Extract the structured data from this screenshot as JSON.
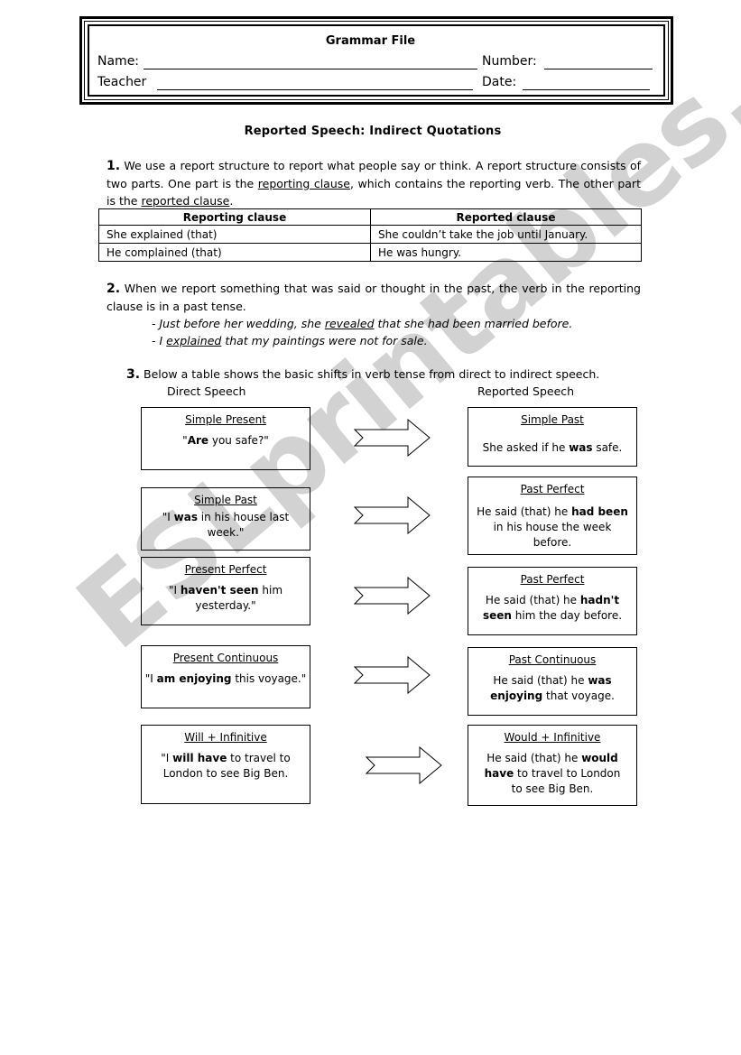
{
  "watermark": "ESLprintables.com",
  "header": {
    "title": "Grammar File",
    "name_label": "Name:",
    "number_label": "Number:",
    "teacher_label": "Teacher",
    "date_label": "Date:"
  },
  "document_title": "Reported Speech: Indirect Quotations",
  "section1": {
    "number": "1.",
    "text_before": " We use a report structure to report what people say or think. A report structure consists of two parts. One part is the ",
    "term1": "reporting clause",
    "text_middle": ", which contains the reporting verb. The other part is the ",
    "term2": "reported clause",
    "text_end": ".",
    "table": {
      "headers": [
        "Reporting clause",
        "Reported clause"
      ],
      "rows": [
        [
          "She explained (that)",
          "She couldn’t take the job until January."
        ],
        [
          "He complained (that)",
          "He was hungry."
        ]
      ]
    }
  },
  "section2": {
    "number": "2.",
    "text": " When we report something that was said or thought in the past, the verb in the reporting clause is in a past tense.",
    "examples": [
      {
        "before": "- Just before her wedding, she ",
        "verb": "revealed",
        "after": " that she had been married before."
      },
      {
        "before": "- I ",
        "verb": "explained",
        "after": " that my paintings were not for sale."
      }
    ]
  },
  "section3": {
    "number": "3.",
    "text": " Below a table shows the basic shifts in verb tense from direct to indirect speech.",
    "direct_label": "Direct Speech",
    "reported_label": "Reported Speech",
    "shifts": [
      {
        "direct_title": "Simple Present",
        "direct": {
          "pre": "\"",
          "bold": "Are",
          "post": " you safe?\""
        },
        "reported_title": "Simple Past",
        "reported": {
          "pre": "She asked if he ",
          "bold": "was",
          "post": " safe."
        }
      },
      {
        "direct_title": "Simple Past",
        "direct": {
          "pre": "\"I ",
          "bold": "was",
          "post": "  in his house last week.\""
        },
        "reported_title": "Past Perfect",
        "reported": {
          "pre": "He said (that) he ",
          "bold": "had been",
          "post": " in his house the week before."
        }
      },
      {
        "direct_title": "Present Perfect",
        "direct": {
          "pre": "\"I ",
          "bold": "haven't seen",
          "post": " him yesterday.\""
        },
        "reported_title": "Past Perfect",
        "reported": {
          "pre": "He said (that) he ",
          "bold": "hadn't seen",
          "post": " him the day before."
        }
      },
      {
        "direct_title": "Present Continuous",
        "direct": {
          "pre": "\"I ",
          "bold": "am enjoying",
          "post": " this voyage.\""
        },
        "reported_title": "Past Continuous",
        "reported": {
          "pre": "He said (that) he ",
          "bold": "was enjoying",
          "post": " that voyage."
        }
      },
      {
        "direct_title": "Will + Infinitive",
        "direct": {
          "pre": "\"I ",
          "bold": "will have",
          "post": " to travel to London to see Big Ben."
        },
        "reported_title": "Would + Infinitive",
        "reported": {
          "pre": "He said (that) he ",
          "bold": "would have",
          "post": " to travel to London to see Big Ben."
        }
      }
    ]
  }
}
